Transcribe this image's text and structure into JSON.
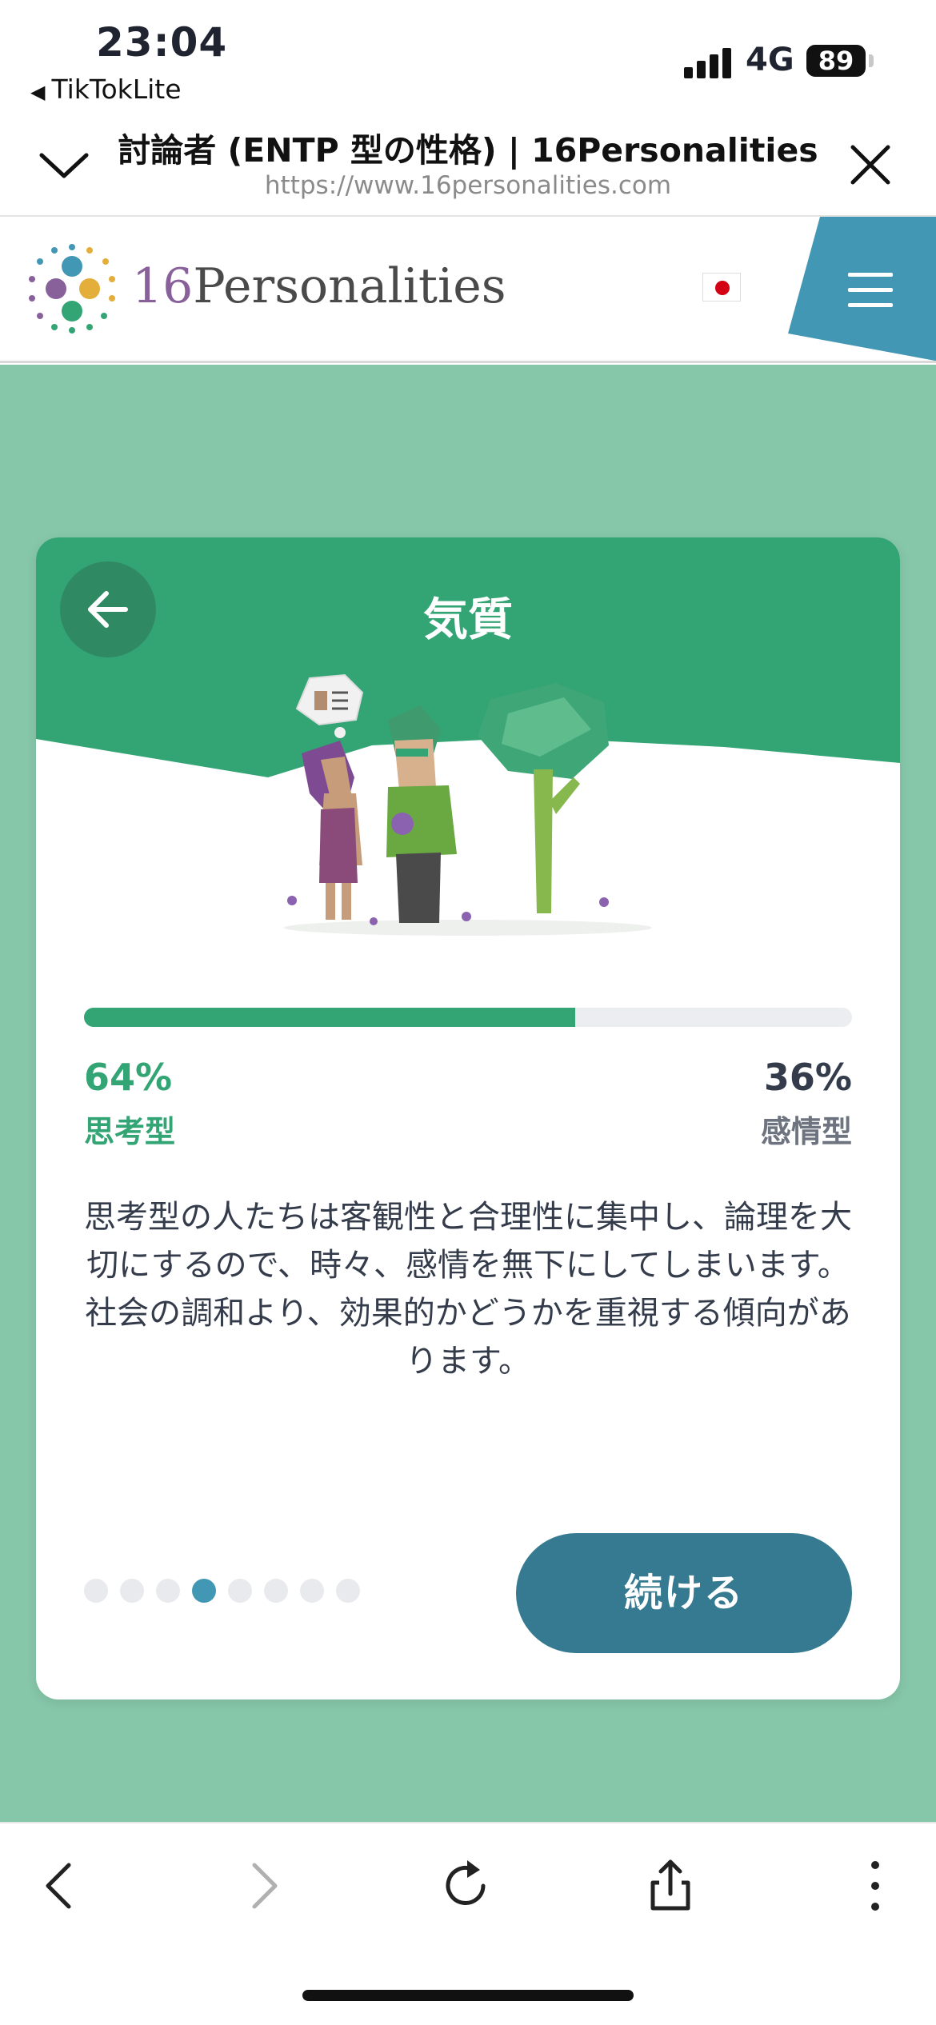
{
  "status_bar": {
    "time": "23:04",
    "back_app": "TikTokLite",
    "network": "4G",
    "battery": "89"
  },
  "browser": {
    "page_title": "討論者 (ENTP 型の性格) | 16Personalities",
    "url": "https://www.16personalities.com"
  },
  "site": {
    "logo_number": "16",
    "logo_word": "Personalities",
    "language_flag": "japan-flag"
  },
  "card": {
    "title": "気質",
    "progress_fraction": 0.64,
    "left_percent": "64%",
    "left_label": "思考型",
    "right_percent": "36%",
    "right_label": "感情型",
    "description": "思考型の人たちは客観性と合理性に集中し、論理を大切にするので、時々、感情を無下にしてしまいます。社会の調和より、効果的かどうかを重視する傾向があります。",
    "pager_total": 8,
    "pager_active_index": 3,
    "continue_label": "続ける"
  },
  "toolbar": {
    "icons": [
      "back-icon",
      "forward-icon",
      "reload-icon",
      "share-icon",
      "more-icon"
    ]
  },
  "colors": {
    "accent_green": "#33a474",
    "page_green": "#86c6a9",
    "button_blue": "#357a90",
    "active_dot": "#4298b4"
  }
}
